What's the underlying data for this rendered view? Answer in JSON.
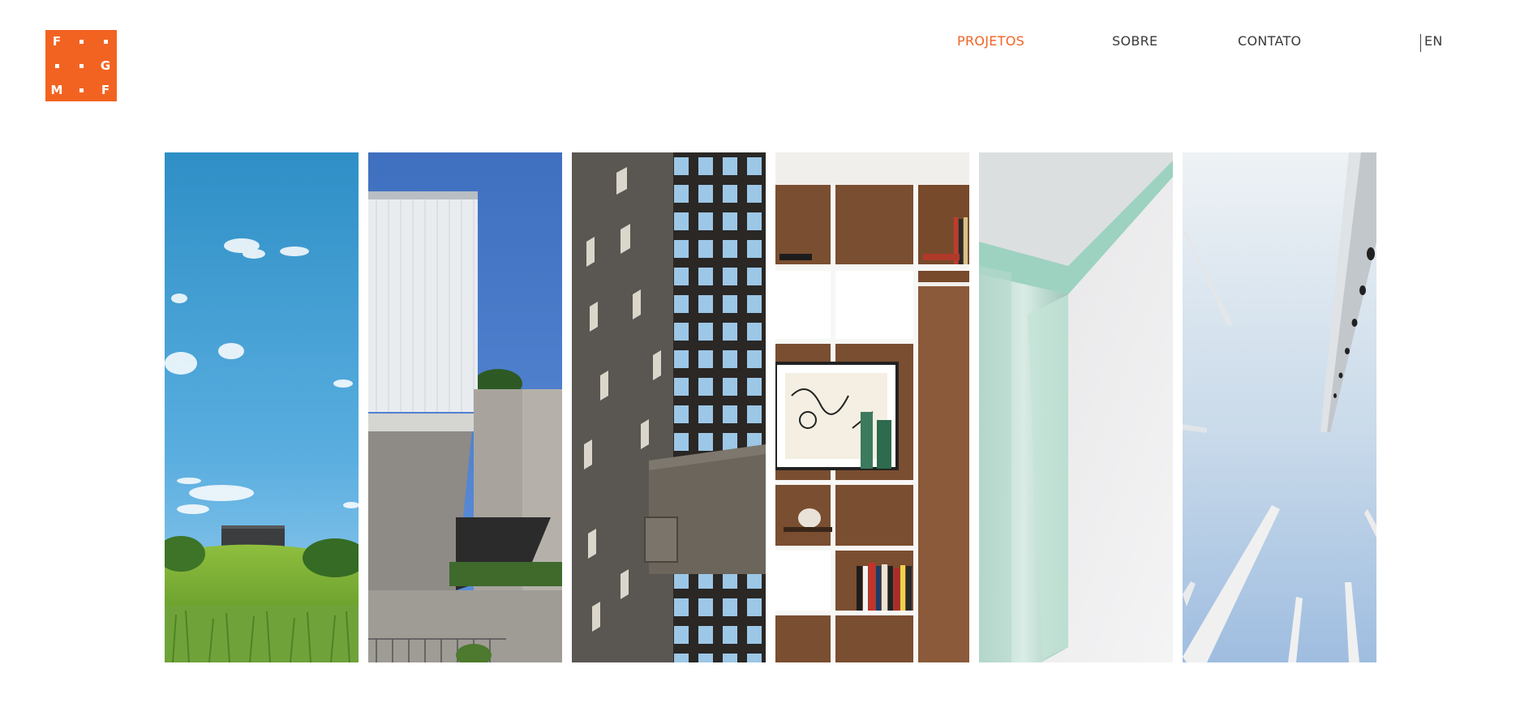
{
  "brand": {
    "logo_letters": [
      "F",
      "G",
      "M",
      "F"
    ],
    "accent_color": "#F26322"
  },
  "nav": {
    "items": [
      {
        "label": "PROJETOS",
        "active": true
      },
      {
        "label": "SOBRE",
        "active": false
      },
      {
        "label": "CONTATO",
        "active": false
      }
    ],
    "language": "EN"
  },
  "gallery": {
    "projects": [
      {
        "icon": "landscape-photo"
      },
      {
        "icon": "concrete-building-photo"
      },
      {
        "icon": "cobogo-facade-photo"
      },
      {
        "icon": "bookshelf-interior-photo"
      },
      {
        "icon": "glass-table-photo"
      },
      {
        "icon": "white-poles-sky-photo"
      }
    ]
  }
}
